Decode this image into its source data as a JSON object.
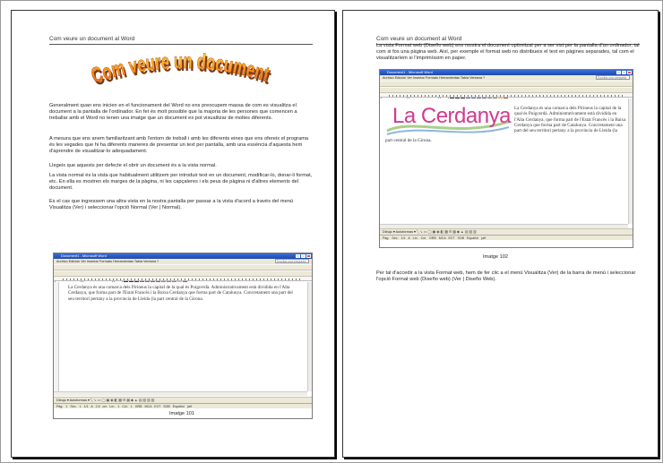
{
  "page1": {
    "header": "Com veure un document al Word",
    "wordart_title": "Com veure un document",
    "paragraphs": [
      "Generalment quan ens inicien en el funcionament del Word no ens preocupem massa de com es visualitza el document a la pantalla de l'ordinador. En fet és molt possible que la majoria de les persones que comencen a treballar amb el Word no tenen una imatge que un document es pot visualitzar de moltes diferents.",
      "A mesura que ens anem familiaritzant amb l'entorn de treball i amb les diferents eines que ens ofereix el programa és les vegades que hi ha diferents maneres de presentar un text per pantalla, amb una essència d'aquesta hem d'aprendre de visualitzar-lo adequadament.",
      "Llegeix que aquests per defecte el obrir un document és a la vista normal.",
      "La vista normal és la vista que habitualment utilitzem per introduir text en un document, modificar-lo, donar-li format, etc. En ella es mostren els marges de la pàgina, ni les capçaleres i els peus de pàgina ni d'altres elements del document.",
      "Es el cas que ingressem una altra vista en la nostra pantalla per passar a la vista d'acord a través del menú Visualitza (Ver) i seleccionar l'opció Normal (Ver | Normal)."
    ],
    "caption": "Imatge 101",
    "window": {
      "title": "Document1 - Microsoft Word",
      "menu": "Archivo  Edición  Ver  Insertar  Formato  Herramientas  Tabla  Ventana  ?",
      "help_box": "Escriba una pregunta",
      "zoom": "100%",
      "doc_text": "La Cerdanya és una comarca dels Pirineus la capital de la qual és Puigcerdà. Administrativament està dividida en l'Alta Cerdanya, que forma part de l'Estat Francès i la Baixa Cerdanya que forma part de Catalunya. Concretament una part del seu territori pertany a la provincia de Lleida (la part central de la Girona.",
      "drawbar": "Dibujo ▾  Autoformas ▾",
      "status": "Pág. 1   Sec. 1   1/1   A 2,5 cm   Lín. 1   Col. 1   GRB  MCA  EXT  SOB  Español (alf"
    }
  },
  "page2": {
    "header": "Com veure un document al Word",
    "paragraph_top": "La vista Format web (Diseño web) ens mostra el document optimitzat per a ser vist per la pantalla d'un ordinador, tal com si fos una pàgina web. Així, per exemple el format web no distribueix el text en pàgines separades, tal com el visualitzaríem si l'imprimíssim en paper.",
    "caption": "Imatge 102",
    "paragraph_bottom": "Per tal d'accedir a la vista Format web, hem de fer clic a el menú Visualitza (Ver) de la barra de menú i seleccionar l'opció Format web (Diseño web) (Ver | Diseño Web).",
    "window": {
      "title": "Document1 - Microsoft Word",
      "menu": "Archivo  Edición  Ver  Insertar  Formato  Herramientas  Tabla  Ventana  ?",
      "help_box": "Escriba una pregunta",
      "zoom": "100%",
      "logo_text": "La Cerdanya",
      "doc_text_right": "La Cerdanya és una comarca dels Pirineus la capital de la qual és Puigcerdà. Administrativament està dividida en l'Alta Cerdanya, que forma part de l'Estat Francès i la Baixa Cerdanya que forma part de Catalunya. Concretament una part del seu territori pertany a la provincia de Lleida (la",
      "doc_text_bottom": "part central de la Girona.",
      "drawbar": "Dibujo ▾  Autoformas ▾",
      "status": "Pág.    Sec.    1/1   A     Lín.    Col.    GRB  MCA  EXT  SOB  Español (alf"
    }
  }
}
